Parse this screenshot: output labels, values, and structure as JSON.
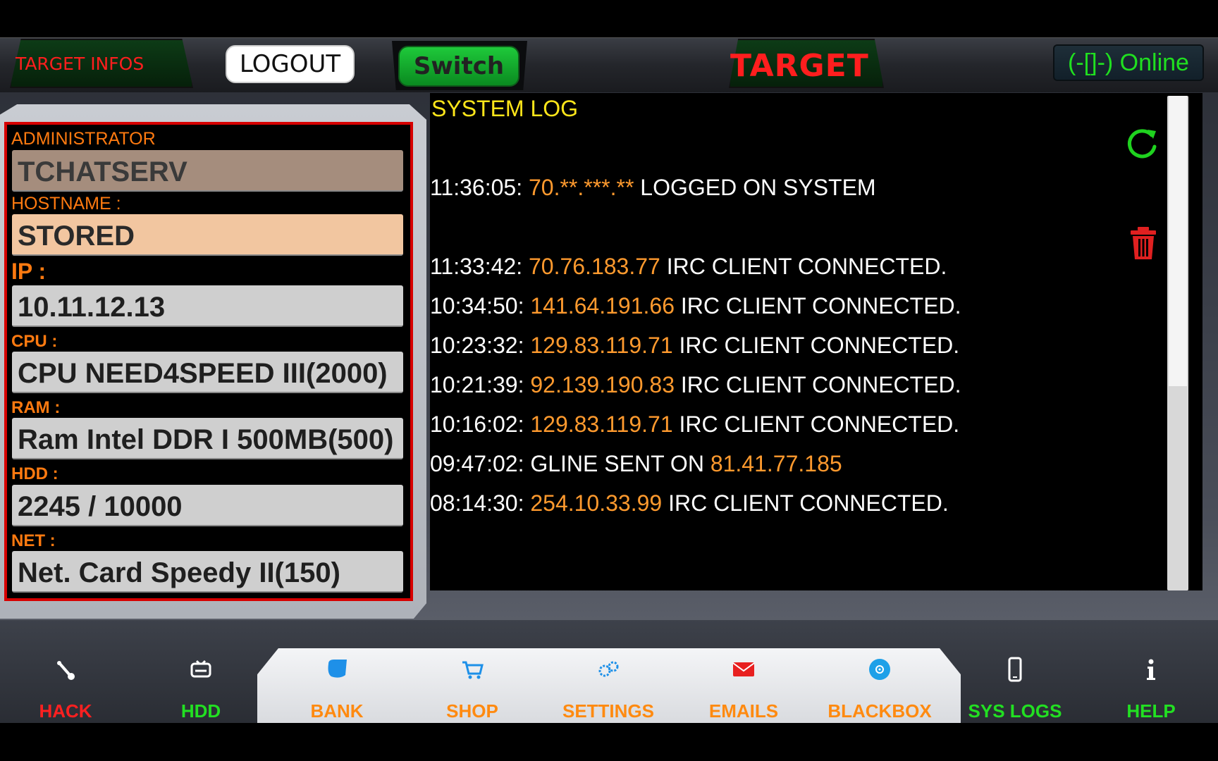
{
  "topbar": {
    "target_infos": "TARGET INFOS",
    "logout": "LOGOUT",
    "switch": "Switch",
    "target": "TARGET",
    "status": "(-[]-) Online"
  },
  "target_info": {
    "administrator_label": "ADMINISTRATOR",
    "administrator_value": "TCHATSERV",
    "hostname_label": "HOSTNAME :",
    "hostname_value": "STORED",
    "ip_label": "IP :",
    "ip_value": "10.11.12.13",
    "cpu_label": "CPU :",
    "cpu_value": "CPU NEED4SPEED III(2000)",
    "ram_label": "RAM :",
    "ram_value": "Ram Intel DDR I 500MB(500)",
    "hdd_label": "HDD :",
    "hdd_value": "2245 / 10000",
    "net_label": "NET :",
    "net_value": "Net. Card Speedy II(150)"
  },
  "system_log": {
    "title": "SYSTEM LOG",
    "entries": [
      {
        "time": "11:36:05: ",
        "ip": "70.**.***.**",
        "before": "",
        "after": " LOGGED ON SYSTEM"
      },
      {
        "time": "11:33:42: ",
        "ip": "70.76.183.77",
        "before": "",
        "after": " IRC CLIENT CONNECTED."
      },
      {
        "time": "10:34:50: ",
        "ip": "141.64.191.66",
        "before": "",
        "after": " IRC CLIENT CONNECTED."
      },
      {
        "time": "10:23:32: ",
        "ip": "129.83.119.71",
        "before": "",
        "after": " IRC CLIENT CONNECTED."
      },
      {
        "time": "10:21:39: ",
        "ip": "92.139.190.83",
        "before": "",
        "after": " IRC CLIENT CONNECTED."
      },
      {
        "time": "10:16:02: ",
        "ip": "129.83.119.71",
        "before": "",
        "after": " IRC CLIENT CONNECTED."
      },
      {
        "time": "09:47:02: ",
        "ip": "81.41.77.185",
        "before": "GLINE SENT ON ",
        "after": ""
      },
      {
        "time": "08:14:30: ",
        "ip": "254.10.33.99",
        "before": "",
        "after": " IRC CLIENT CONNECTED."
      }
    ]
  },
  "nav": [
    {
      "label": "HACK",
      "icon": "wrench-icon",
      "color": "#ff2020"
    },
    {
      "label": "HDD",
      "icon": "hdd-icon",
      "color": "#22e022"
    },
    {
      "label": "BANK",
      "icon": "bank-icon",
      "color": "#ff8a10"
    },
    {
      "label": "SHOP",
      "icon": "cart-icon",
      "color": "#ff8a10"
    },
    {
      "label": "SETTINGS",
      "icon": "gears-icon",
      "color": "#ff8a10"
    },
    {
      "label": "EMAILS",
      "icon": "mail-icon",
      "color": "#ff8a10"
    },
    {
      "label": "BLACKBOX",
      "icon": "blackbox-icon",
      "color": "#ff8a10"
    },
    {
      "label": "SYS LOGS",
      "icon": "phone-icon",
      "color": "#22e022"
    },
    {
      "label": "HELP",
      "icon": "info-icon",
      "color": "#22e022"
    }
  ]
}
